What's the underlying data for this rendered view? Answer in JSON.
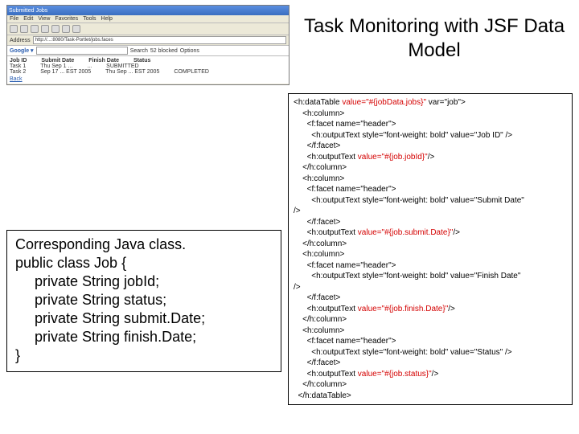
{
  "title": "Task Monitoring with JSF Data Model",
  "browser": {
    "window_title": "Submitted Jobs",
    "menu": [
      "File",
      "Edit",
      "View",
      "Favorites",
      "Tools",
      "Help"
    ],
    "address_label": "Address",
    "address_value": "http://...:8080/Task-Portlet/jobs.faces",
    "google_label": "Google ▾",
    "google_btn1": "Search",
    "google_btn2": "52 blocked",
    "google_btn3": "Options",
    "headers": [
      "Job ID",
      "Submit Date",
      "Finish Date",
      "Status"
    ],
    "row1": [
      "Task 1",
      "Thu Sep 1 ...",
      "...",
      "SUBMITTED"
    ],
    "row2": [
      "Task 2",
      "Sep 17 ... EST 2005",
      "Thu Sep ... EST 2005",
      "COMPLETED"
    ],
    "back_link": "Back"
  },
  "java": {
    "l1": "Corresponding Java class.",
    "l2": "public class Job {",
    "l3": "private String jobId;",
    "l4": "private String status;",
    "l5": "private String submit.Date;",
    "l6": "private String finish.Date;",
    "l7": "}"
  },
  "x": {
    "a1": "<h:dataTable ",
    "a1r": "value=\"#{jobData.jobs}\"",
    "a1b": " var=\"job\">",
    "a2": "    <h:column>",
    "a3": "      <f:facet name=\"header\">",
    "a4": "        <h:outputText style=\"font-weight: bold\" value=\"Job ID\" />",
    "a5": "      </f:facet>",
    "a6a": "      <h:outputText ",
    "a6r": "value=\"#{job.jobId}\"",
    "a6b": "/>",
    "a7": "    </h:column>",
    "a8": "    <h:column>",
    "a9": "      <f:facet name=\"header\">",
    "a10": "        <h:outputText style=\"font-weight: bold\" value=\"Submit Date\"",
    "a11": "/>",
    "a12": "      </f:facet>",
    "a13a": "      <h:outputText ",
    "a13r": "value=\"#{job.submit.Date}\"",
    "a13b": "/>",
    "a14": "    </h:column>",
    "a15": "    <h:column>",
    "a16": "      <f:facet name=\"header\">",
    "a17": "        <h:outputText style=\"font-weight: bold\" value=\"Finish Date\"",
    "a18": "/>",
    "a19": "      </f:facet>",
    "a20a": "      <h:outputText ",
    "a20r": "value=\"#{job.finish.Date}\"",
    "a20b": "/>",
    "a21": "    </h:column>",
    "a22": "    <h:column>",
    "a23": "      <f:facet name=\"header\">",
    "a24": "        <h:outputText style=\"font-weight: bold\" value=\"Status\" />",
    "a25": "      </f:facet>",
    "a26a": "      <h:outputText ",
    "a26r": "value=\"#{job.status}\"",
    "a26b": "/>",
    "a27": "    </h:column>",
    "a28": "  </h:dataTable>"
  }
}
